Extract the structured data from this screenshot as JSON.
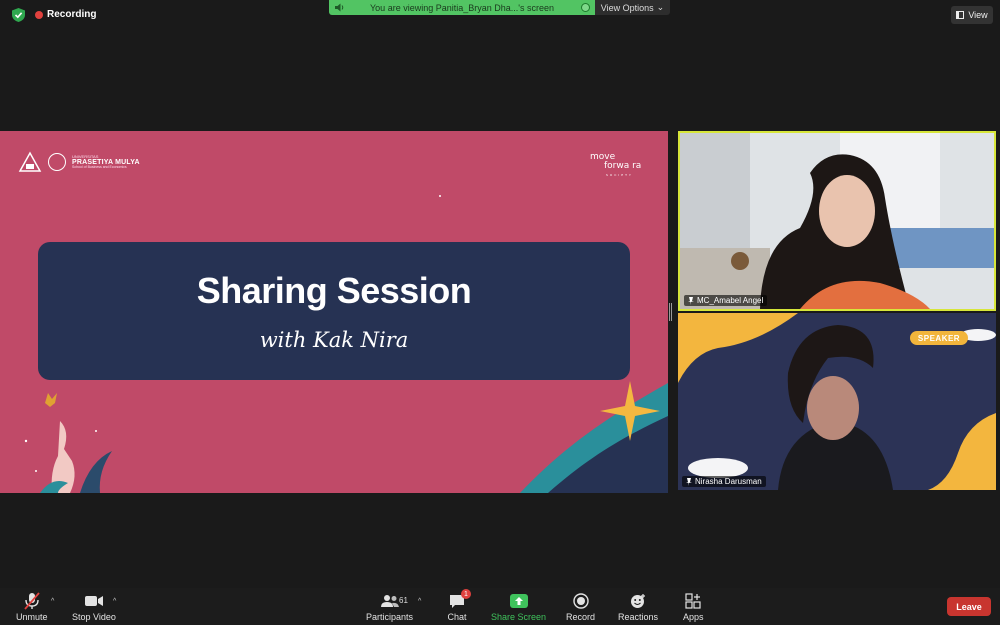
{
  "recording": {
    "label": "Recording"
  },
  "banner": {
    "text": "You are viewing Panitia_Bryan Dha...'s screen"
  },
  "view_options": {
    "label": "View Options"
  },
  "view_button": {
    "label": "View"
  },
  "slide": {
    "title": "Sharing Session",
    "subtitle": "with Kak Nira",
    "logo_line1": "UNIVERSITAS",
    "logo_line2": "PRASETIYA MULYA",
    "logo_line3": "School of Business and Economics",
    "brand_line1": "move",
    "brand_line2": "forwa  ra",
    "brand_line3": "SOCIETY"
  },
  "participants": [
    {
      "name": "MC_Amabel Angel"
    },
    {
      "name": "Nirasha Darusman",
      "badge": "SPEAKER"
    }
  ],
  "toolbar": {
    "unmute": "Unmute",
    "stop_video": "Stop Video",
    "participants": "Participants",
    "participants_count": "61",
    "chat": "Chat",
    "chat_unread": "1",
    "share_screen": "Share Screen",
    "record": "Record",
    "reactions": "Reactions",
    "apps": "Apps",
    "leave": "Leave"
  },
  "colors": {
    "slide_bg": "#c04a68",
    "title_card": "#263253",
    "banner": "#52c463",
    "active_speaker_border": "#d7e63a",
    "leave": "#c8352f",
    "share_green": "#3fc25c"
  }
}
